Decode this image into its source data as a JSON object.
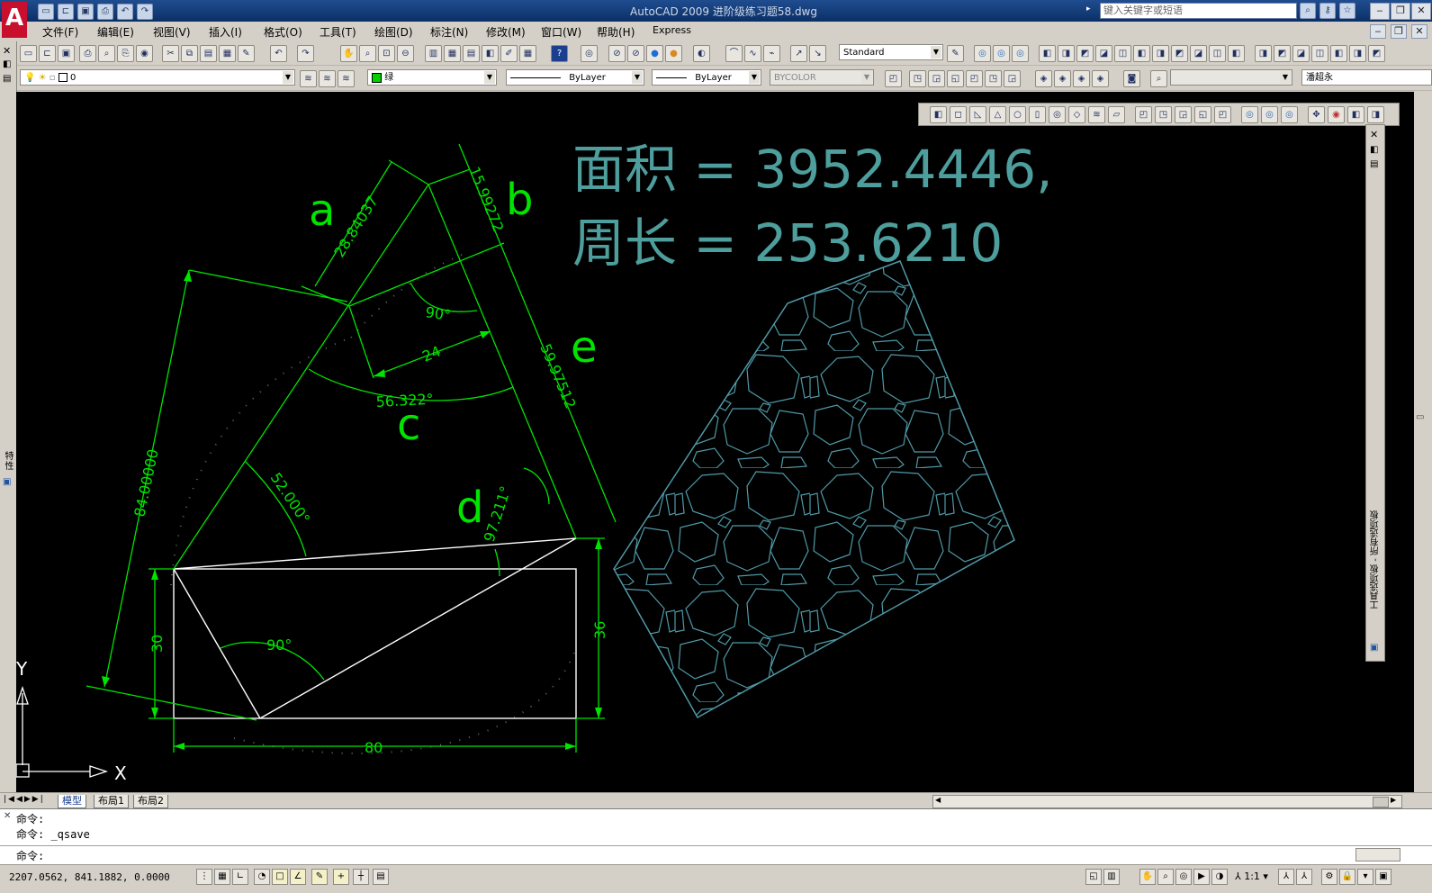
{
  "window": {
    "title": "AutoCAD 2009 进阶级练习题58.dwg",
    "search_placeholder": "键入关键字或短语",
    "quick_access": [
      "new-icon",
      "open-icon",
      "save-icon",
      "print-icon",
      "undo-icon",
      "redo-icon"
    ]
  },
  "menu": {
    "items": [
      "文件(F)",
      "编辑(E)",
      "视图(V)",
      "插入(I)",
      "格式(O)",
      "工具(T)",
      "绘图(D)",
      "标注(N)",
      "修改(M)",
      "窗口(W)",
      "帮助(H)",
      "Express"
    ]
  },
  "toolbar": {
    "text_style": "Standard",
    "layer": "0",
    "color": "绿",
    "linetype": "ByLayer",
    "lineweight": "ByLayer",
    "plotstyle": "BYCOLOR",
    "user_field": "潘超永"
  },
  "drawing": {
    "area_text": "面积 = 3952.4446,",
    "perimeter_text": "周长 = 253.6210",
    "labels": {
      "a": "a",
      "b": "b",
      "c": "c",
      "d": "d",
      "e": "e"
    },
    "dims": {
      "d1": "28.84037",
      "d2": "15.99272",
      "d3": "90°",
      "d4": "24",
      "d5": "59.97512",
      "d6": "56.322°",
      "d7": "84.00000",
      "d8": "52.000°",
      "d9": "97.211°",
      "d10": "90°",
      "d11": "30",
      "d12": "36",
      "d13": "80"
    },
    "ucs": {
      "x": "X",
      "y": "Y"
    },
    "colors": {
      "dimension": "#00e400",
      "annotation": "#4d9e9c",
      "geometry": "#ffffff",
      "hatch": "#4f9aa8",
      "background": "#000000"
    }
  },
  "palette": {
    "title": "工具选项板 - 所有选项板",
    "properties_label": "特性"
  },
  "tabs": [
    "模型",
    "布局1",
    "布局2"
  ],
  "command": {
    "lines": [
      "命令:",
      "命令: _qsave"
    ],
    "prompt": "命令:"
  },
  "status": {
    "coordinates": "2207.0562, 841.1882, 0.0000",
    "scale": "1:1"
  }
}
